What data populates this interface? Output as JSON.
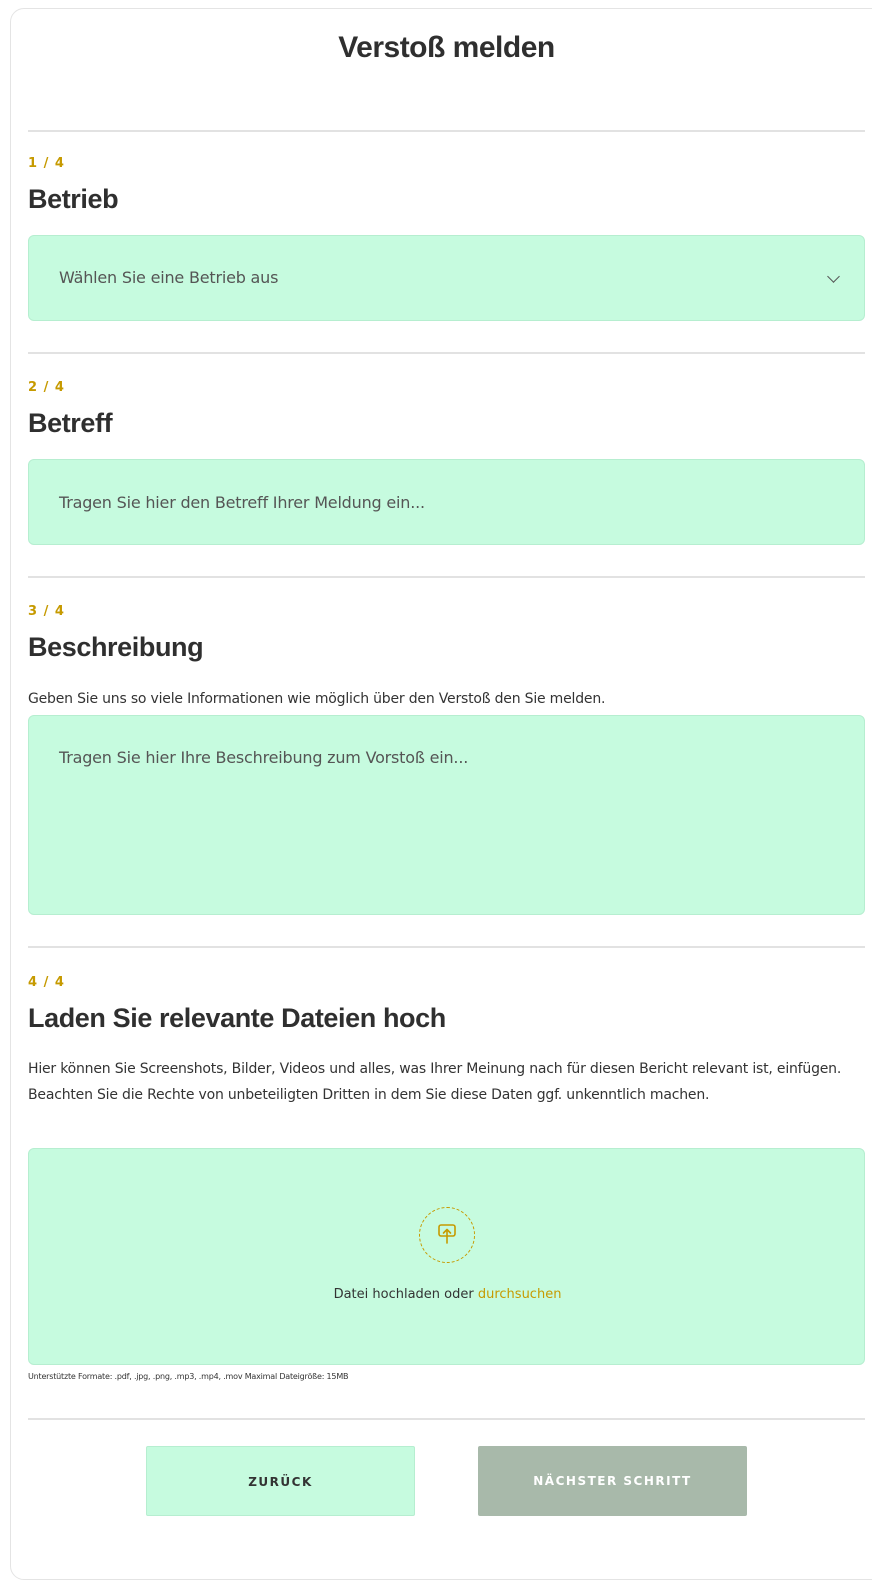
{
  "form": {
    "title": "Verstoß melden"
  },
  "steps": [
    {
      "counter": "1 / 4",
      "heading": "Betrieb",
      "select_placeholder": "Wählen Sie eine Betrieb aus"
    },
    {
      "counter": "2 / 4",
      "heading": "Betreff",
      "input_placeholder": "Tragen Sie hier den Betreff Ihrer Meldung ein..."
    },
    {
      "counter": "3 / 4",
      "heading": "Beschreibung",
      "help": "Geben Sie uns so viele Informationen wie möglich über den Verstoß den Sie melden.",
      "textarea_placeholder": "Tragen Sie hier Ihre Beschreibung zum Vorstoß ein..."
    },
    {
      "counter": "4 / 4",
      "heading": "Laden Sie relevante Dateien hoch",
      "help": "Hier können Sie Screenshots, Bilder, Videos und alles, was Ihrer Meinung nach für diesen Bericht relevant ist, einfügen. Beachten Sie die Rechte von unbeteiligten Dritten in dem Sie diese Daten ggf. unkenntlich machen.",
      "upload_text": "Datei hochladen oder",
      "upload_link": "durchsuchen",
      "upload_icon": "upload-icon",
      "formats": "Unterstützte Formate:  .pdf, .jpg, .png, .mp3, .mp4, .mov Maximal Dateigröße: 15MB"
    }
  ],
  "buttons": {
    "back": "ZURÜCK",
    "next": "NÄCHSTER SCHRITT"
  },
  "colors": {
    "accent": "#c69a00",
    "field_bg": "#c6fbdf",
    "next_button_bg": "#a8b9aa",
    "heading_text": "#2f2f2f"
  }
}
